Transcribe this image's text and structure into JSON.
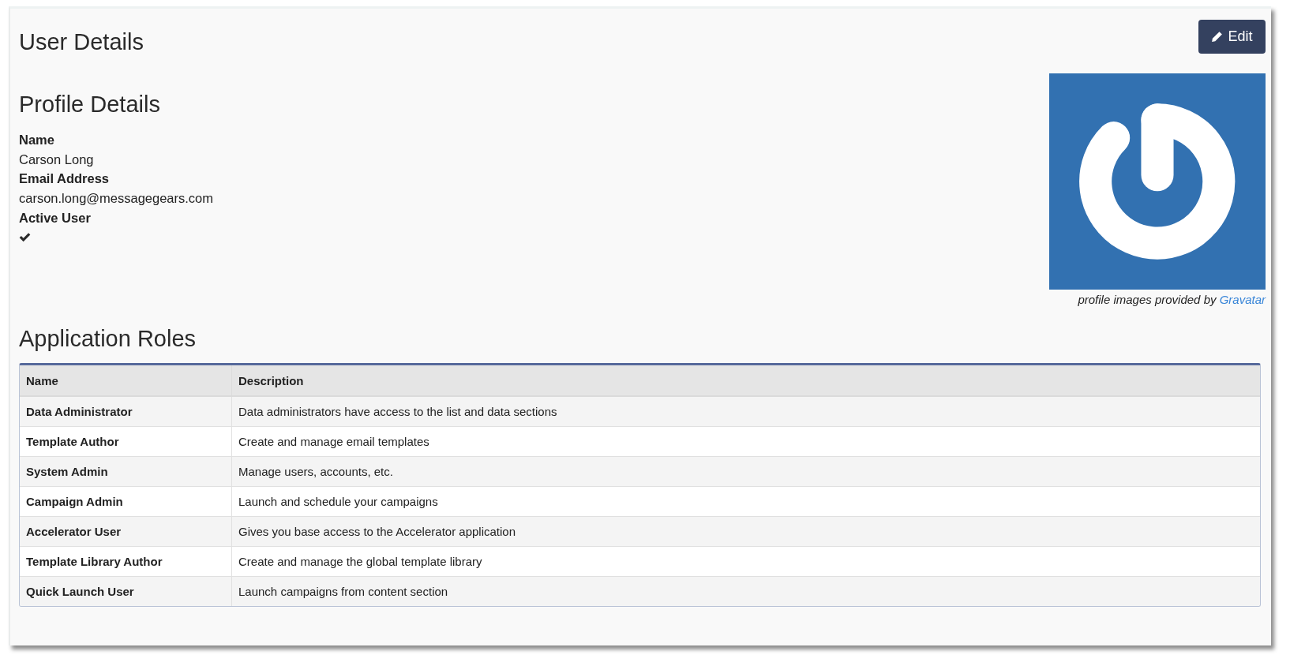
{
  "page": {
    "title": "User Details"
  },
  "edit_button": {
    "label": "Edit"
  },
  "profile": {
    "heading": "Profile Details",
    "fields": [
      {
        "label": "Name",
        "kind": "text",
        "value": "Carson Long"
      },
      {
        "label": "Email Address",
        "kind": "text",
        "value": "carson.long@messagegears.com"
      },
      {
        "label": "Active User",
        "kind": "check",
        "checked": true
      }
    ]
  },
  "avatar": {
    "caption": "profile images provided by",
    "caption_link": "Gravatar"
  },
  "roles": {
    "heading": "Application Roles",
    "table": {
      "columns": [
        "Name",
        "Description"
      ],
      "rows": [
        {
          "name": "Data Administrator",
          "description": "Data administrators have access to the list and data sections"
        },
        {
          "name": "Template Author",
          "description": "Create and manage email templates"
        },
        {
          "name": "System Admin",
          "description": "Manage users, accounts, etc."
        },
        {
          "name": "Campaign Admin",
          "description": "Launch and schedule your campaigns"
        },
        {
          "name": "Accelerator User",
          "description": "Gives you base access to the Accelerator application"
        },
        {
          "name": "Template Library Author",
          "description": "Create and manage the global template library"
        },
        {
          "name": "Quick Launch User",
          "description": "Launch campaigns from content section"
        }
      ]
    }
  }
}
